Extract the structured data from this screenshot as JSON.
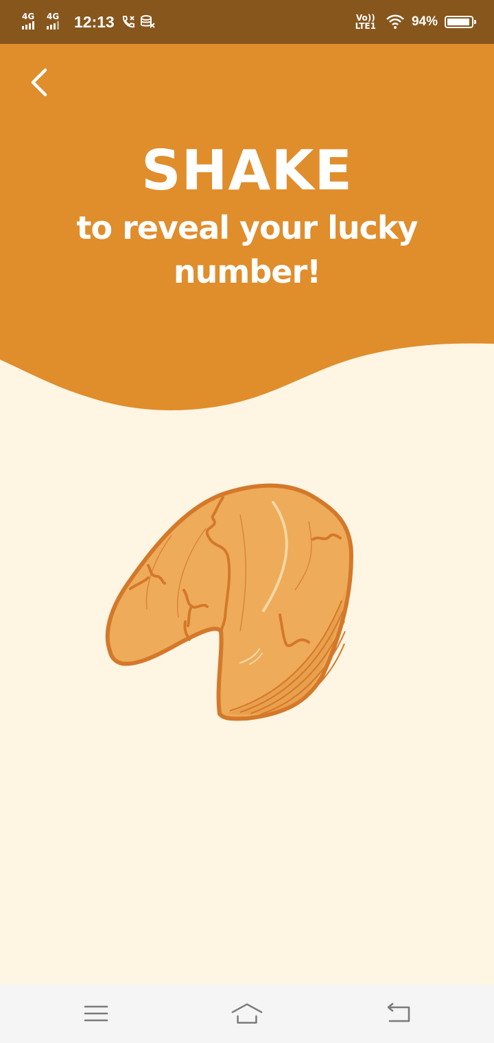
{
  "status_bar": {
    "network_1": "4G",
    "network_2": "4G",
    "time": "12:13",
    "volte_top": "Vo))",
    "volte_bottom": "LTE1",
    "battery_percent": "94%",
    "battery_level": 0.94,
    "icons": [
      "signal-icon",
      "call-icon",
      "data-icon",
      "wifi-icon",
      "battery-icon"
    ]
  },
  "header": {
    "title": "SHAKE",
    "subtitle": "to reveal your lucky number!"
  },
  "colors": {
    "status_bar": "#87561D",
    "header": "#E08D2B",
    "background": "#FFF5E3",
    "cookie_fill": "#EEAB5A",
    "cookie_stroke": "#D4782A",
    "nav_bar": "#F5F5F5"
  },
  "navigation": {
    "icons": [
      "menu-icon",
      "home-icon",
      "back-nav-icon"
    ]
  }
}
